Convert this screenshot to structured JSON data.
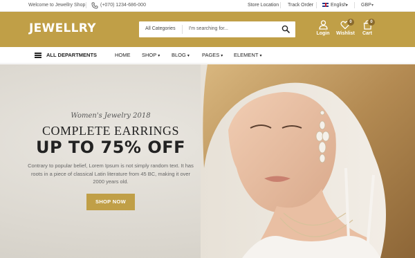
{
  "topbar": {
    "welcome": "Welcome to Jewellry Shop!",
    "phone": "(+070) 1234-686-000",
    "store_location": "Store Location",
    "track_order": "Track Order",
    "language": "English",
    "currency": "GBP"
  },
  "header": {
    "logo": "JEWELLRY",
    "search_category": "All Categories",
    "search_placeholder": "I'm searching for...",
    "login_label": "Login",
    "wishlist_label": "Wishlist",
    "wishlist_count": "0",
    "cart_label": "Cart",
    "cart_count": "0"
  },
  "nav": {
    "departments": "ALL DEPARTMENTS",
    "items": [
      "HOME",
      "SHOP",
      "BLOG",
      "PAGES",
      "ELEMENT"
    ]
  },
  "hero": {
    "subtitle": "Women's Jewelry 2018",
    "title": "COMPLETE EARRINGS",
    "headline": "UP TO 75% OFF",
    "description": "Contrary to popular belief, Lorem Ipsum is not simply random text. It has roots in a piece of classical Latin literature from 45 BC, making it over 2000 years old.",
    "button": "SHOP NOW"
  },
  "colors": {
    "brand_gold": "#c09f47",
    "badge": "#8a6a2c"
  },
  "icons": [
    "phone-icon",
    "uk-flag-icon",
    "search-icon",
    "user-icon",
    "heart-icon",
    "bag-icon",
    "hamburger-icon",
    "chevron-down-icon"
  ]
}
